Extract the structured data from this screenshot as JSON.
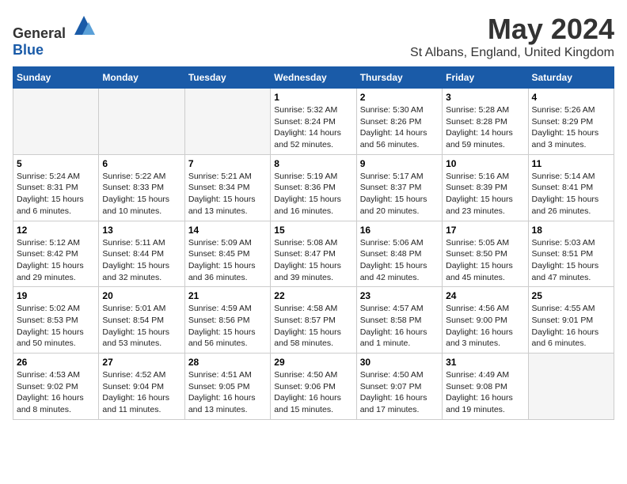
{
  "header": {
    "logo_general": "General",
    "logo_blue": "Blue",
    "title": "May 2024",
    "location": "St Albans, England, United Kingdom"
  },
  "days_of_week": [
    "Sunday",
    "Monday",
    "Tuesday",
    "Wednesday",
    "Thursday",
    "Friday",
    "Saturday"
  ],
  "weeks": [
    [
      {
        "day": "",
        "info": ""
      },
      {
        "day": "",
        "info": ""
      },
      {
        "day": "",
        "info": ""
      },
      {
        "day": "1",
        "info": "Sunrise: 5:32 AM\nSunset: 8:24 PM\nDaylight: 14 hours and 52 minutes."
      },
      {
        "day": "2",
        "info": "Sunrise: 5:30 AM\nSunset: 8:26 PM\nDaylight: 14 hours and 56 minutes."
      },
      {
        "day": "3",
        "info": "Sunrise: 5:28 AM\nSunset: 8:28 PM\nDaylight: 14 hours and 59 minutes."
      },
      {
        "day": "4",
        "info": "Sunrise: 5:26 AM\nSunset: 8:29 PM\nDaylight: 15 hours and 3 minutes."
      }
    ],
    [
      {
        "day": "5",
        "info": "Sunrise: 5:24 AM\nSunset: 8:31 PM\nDaylight: 15 hours and 6 minutes."
      },
      {
        "day": "6",
        "info": "Sunrise: 5:22 AM\nSunset: 8:33 PM\nDaylight: 15 hours and 10 minutes."
      },
      {
        "day": "7",
        "info": "Sunrise: 5:21 AM\nSunset: 8:34 PM\nDaylight: 15 hours and 13 minutes."
      },
      {
        "day": "8",
        "info": "Sunrise: 5:19 AM\nSunset: 8:36 PM\nDaylight: 15 hours and 16 minutes."
      },
      {
        "day": "9",
        "info": "Sunrise: 5:17 AM\nSunset: 8:37 PM\nDaylight: 15 hours and 20 minutes."
      },
      {
        "day": "10",
        "info": "Sunrise: 5:16 AM\nSunset: 8:39 PM\nDaylight: 15 hours and 23 minutes."
      },
      {
        "day": "11",
        "info": "Sunrise: 5:14 AM\nSunset: 8:41 PM\nDaylight: 15 hours and 26 minutes."
      }
    ],
    [
      {
        "day": "12",
        "info": "Sunrise: 5:12 AM\nSunset: 8:42 PM\nDaylight: 15 hours and 29 minutes."
      },
      {
        "day": "13",
        "info": "Sunrise: 5:11 AM\nSunset: 8:44 PM\nDaylight: 15 hours and 32 minutes."
      },
      {
        "day": "14",
        "info": "Sunrise: 5:09 AM\nSunset: 8:45 PM\nDaylight: 15 hours and 36 minutes."
      },
      {
        "day": "15",
        "info": "Sunrise: 5:08 AM\nSunset: 8:47 PM\nDaylight: 15 hours and 39 minutes."
      },
      {
        "day": "16",
        "info": "Sunrise: 5:06 AM\nSunset: 8:48 PM\nDaylight: 15 hours and 42 minutes."
      },
      {
        "day": "17",
        "info": "Sunrise: 5:05 AM\nSunset: 8:50 PM\nDaylight: 15 hours and 45 minutes."
      },
      {
        "day": "18",
        "info": "Sunrise: 5:03 AM\nSunset: 8:51 PM\nDaylight: 15 hours and 47 minutes."
      }
    ],
    [
      {
        "day": "19",
        "info": "Sunrise: 5:02 AM\nSunset: 8:53 PM\nDaylight: 15 hours and 50 minutes."
      },
      {
        "day": "20",
        "info": "Sunrise: 5:01 AM\nSunset: 8:54 PM\nDaylight: 15 hours and 53 minutes."
      },
      {
        "day": "21",
        "info": "Sunrise: 4:59 AM\nSunset: 8:56 PM\nDaylight: 15 hours and 56 minutes."
      },
      {
        "day": "22",
        "info": "Sunrise: 4:58 AM\nSunset: 8:57 PM\nDaylight: 15 hours and 58 minutes."
      },
      {
        "day": "23",
        "info": "Sunrise: 4:57 AM\nSunset: 8:58 PM\nDaylight: 16 hours and 1 minute."
      },
      {
        "day": "24",
        "info": "Sunrise: 4:56 AM\nSunset: 9:00 PM\nDaylight: 16 hours and 3 minutes."
      },
      {
        "day": "25",
        "info": "Sunrise: 4:55 AM\nSunset: 9:01 PM\nDaylight: 16 hours and 6 minutes."
      }
    ],
    [
      {
        "day": "26",
        "info": "Sunrise: 4:53 AM\nSunset: 9:02 PM\nDaylight: 16 hours and 8 minutes."
      },
      {
        "day": "27",
        "info": "Sunrise: 4:52 AM\nSunset: 9:04 PM\nDaylight: 16 hours and 11 minutes."
      },
      {
        "day": "28",
        "info": "Sunrise: 4:51 AM\nSunset: 9:05 PM\nDaylight: 16 hours and 13 minutes."
      },
      {
        "day": "29",
        "info": "Sunrise: 4:50 AM\nSunset: 9:06 PM\nDaylight: 16 hours and 15 minutes."
      },
      {
        "day": "30",
        "info": "Sunrise: 4:50 AM\nSunset: 9:07 PM\nDaylight: 16 hours and 17 minutes."
      },
      {
        "day": "31",
        "info": "Sunrise: 4:49 AM\nSunset: 9:08 PM\nDaylight: 16 hours and 19 minutes."
      },
      {
        "day": "",
        "info": ""
      }
    ]
  ]
}
